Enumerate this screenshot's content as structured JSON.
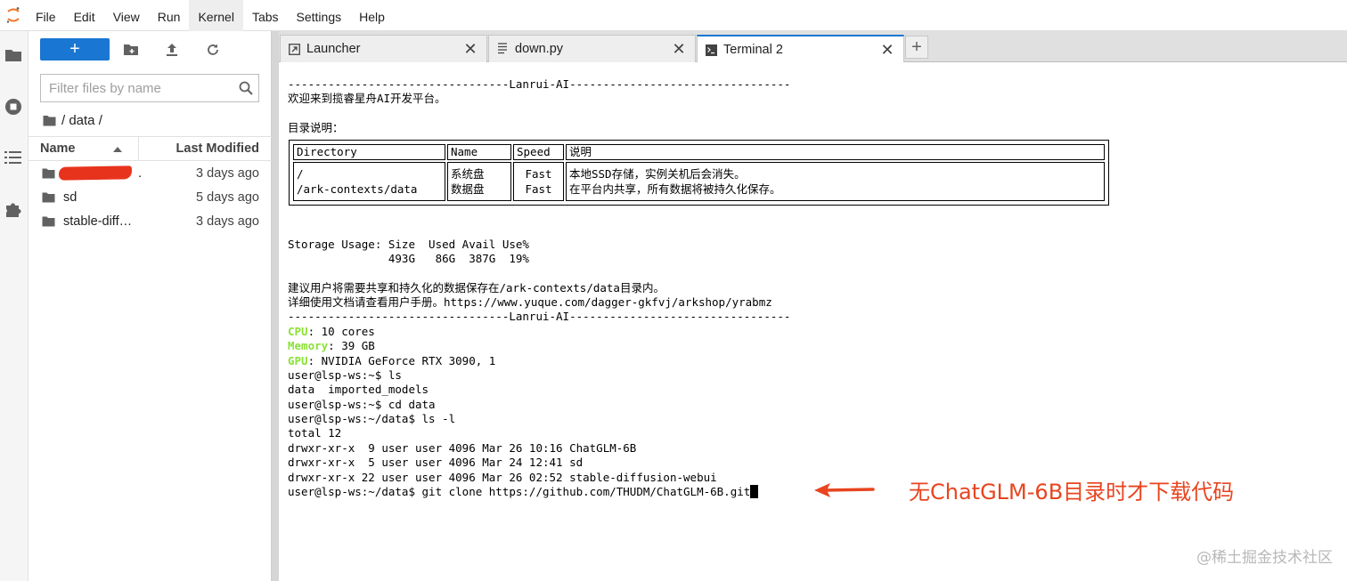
{
  "menubar": {
    "logo_icon": "jupyter-logo-icon",
    "items": [
      "File",
      "Edit",
      "View",
      "Run",
      "Kernel",
      "Tabs",
      "Settings",
      "Help"
    ],
    "active_item": "Kernel"
  },
  "activity_bar": {
    "icons": [
      "folder-icon",
      "running-icon",
      "toc-icon",
      "extension-icon"
    ]
  },
  "file_browser": {
    "new_button_label": "+",
    "toolbar_icons": [
      "new-folder-icon",
      "upload-icon",
      "refresh-icon"
    ],
    "filter_placeholder": "Filter files by name",
    "breadcrumb": "/ data /",
    "columns": {
      "name": "Name",
      "modified": "Last Modified"
    },
    "files": [
      {
        "name": ".",
        "modified": "3 days ago",
        "redacted": true
      },
      {
        "name": "sd",
        "modified": "5 days ago",
        "redacted": false
      },
      {
        "name": "stable-diff…",
        "modified": "3 days ago",
        "redacted": false
      }
    ]
  },
  "tabs": [
    {
      "label": "Launcher",
      "icon": "launcher-icon",
      "active": false
    },
    {
      "label": "down.py",
      "icon": "file-icon",
      "active": false
    },
    {
      "label": "Terminal 2",
      "icon": "terminal-icon",
      "active": true
    }
  ],
  "terminal": {
    "header_line": "---------------------------------Lanrui-AI---------------------------------",
    "welcome": "欢迎来到揽睿星舟AI开发平台。",
    "dir_title": "目录说明：",
    "dir_table": {
      "headers": [
        "Directory",
        "Name",
        "Speed",
        "说明"
      ],
      "dirs": "/\n/ark-contexts/data",
      "names": "系统盘\n数据盘",
      "speeds": "Fast\nFast",
      "desc": "本地SSD存储，实例关机后会消失。\n在平台内共享，所有数据将被持久化保存。"
    },
    "storage_header": "Storage Usage: Size  Used Avail Use%",
    "storage_values": "               493G   86G  387G  19%",
    "advice1": "建议用户将需要共享和持久化的数据保存在/ark-contexts/data目录内。",
    "advice2": "详细使用文档请查看用户手册。https://www.yuque.com/dagger-gkfvj/arkshop/yrabmz",
    "footer_line": "---------------------------------Lanrui-AI---------------------------------",
    "cpu_label": "CPU",
    "cpu_value": ": 10 cores",
    "mem_label": "Memory",
    "mem_value": ": 39 GB",
    "gpu_label": "GPU",
    "gpu_value": ": NVIDIA GeForce RTX 3090, 1",
    "cmd1": "user@lsp-ws:~$ ls",
    "out1": "data  imported_models",
    "cmd2": "user@lsp-ws:~$ cd data",
    "cmd3": "user@lsp-ws:~/data$ ls -l",
    "out_total": "total 12",
    "out_l1": "drwxr-xr-x  9 user user 4096 Mar 26 10:16 ChatGLM-6B",
    "out_l2": "drwxr-xr-x  5 user user 4096 Mar 24 12:41 sd",
    "out_l3": "drwxr-xr-x 22 user user 4096 Mar 26 02:52 stable-diffusion-webui",
    "cmd4": "user@lsp-ws:~/data$ git clone https://github.com/THUDM/ChatGLM-6B.git",
    "green_color": "#8ae234"
  },
  "annotation": {
    "text": "无ChatGLM-6B目录时才下载代码",
    "color": "#e8441f"
  },
  "watermark": "@稀土掘金技术社区"
}
